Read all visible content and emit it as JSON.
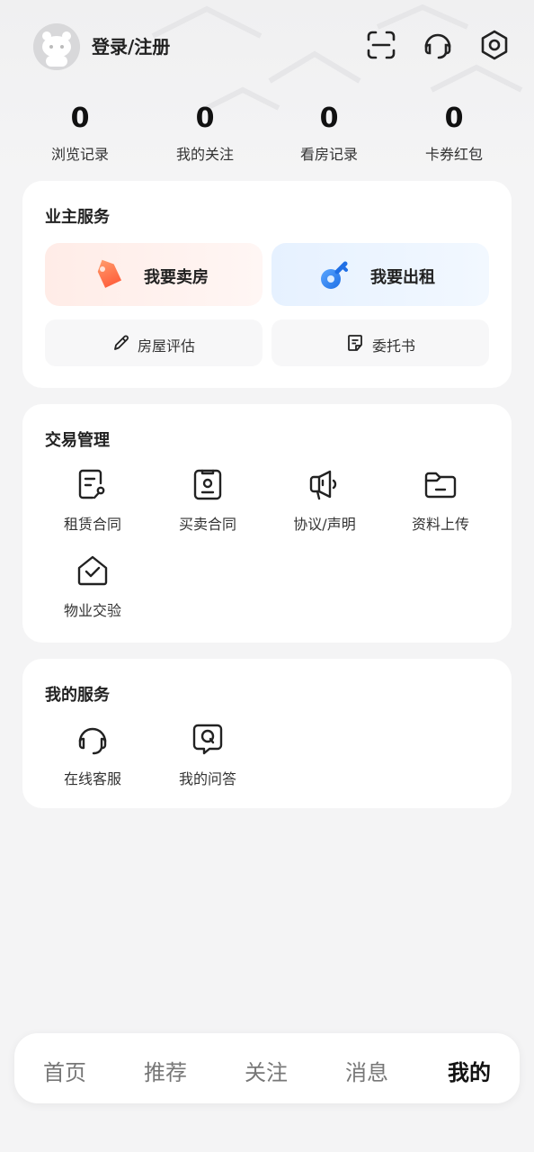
{
  "header": {
    "login_label": "登录/注册",
    "icons": [
      "scan-icon",
      "headset-icon",
      "settings-icon"
    ]
  },
  "stats": [
    {
      "value": "0",
      "label": "浏览记录"
    },
    {
      "value": "0",
      "label": "我的关注"
    },
    {
      "value": "0",
      "label": "看房记录"
    },
    {
      "value": "0",
      "label": "卡券红包"
    }
  ],
  "owner_services": {
    "title": "业主服务",
    "sell_label": "我要卖房",
    "rent_label": "我要出租",
    "evaluate_label": "房屋评估",
    "entrust_label": "委托书"
  },
  "transaction": {
    "title": "交易管理",
    "items": [
      {
        "label": "租赁合同",
        "icon": "lease-contract-icon"
      },
      {
        "label": "买卖合同",
        "icon": "sale-contract-icon"
      },
      {
        "label": "协议/声明",
        "icon": "megaphone-icon"
      },
      {
        "label": "资料上传",
        "icon": "folder-icon"
      },
      {
        "label": "物业交验",
        "icon": "house-check-icon"
      }
    ]
  },
  "my_services": {
    "title": "我的服务",
    "items": [
      {
        "label": "在线客服",
        "icon": "headset-icon"
      },
      {
        "label": "我的问答",
        "icon": "qa-icon"
      }
    ]
  },
  "tabbar": {
    "items": [
      "首页",
      "推荐",
      "关注",
      "消息",
      "我的"
    ],
    "active": "我的"
  },
  "colors": {
    "sell_accent": "#ff6a45",
    "rent_accent": "#2f7ff0",
    "background": "#f4f4f5"
  }
}
